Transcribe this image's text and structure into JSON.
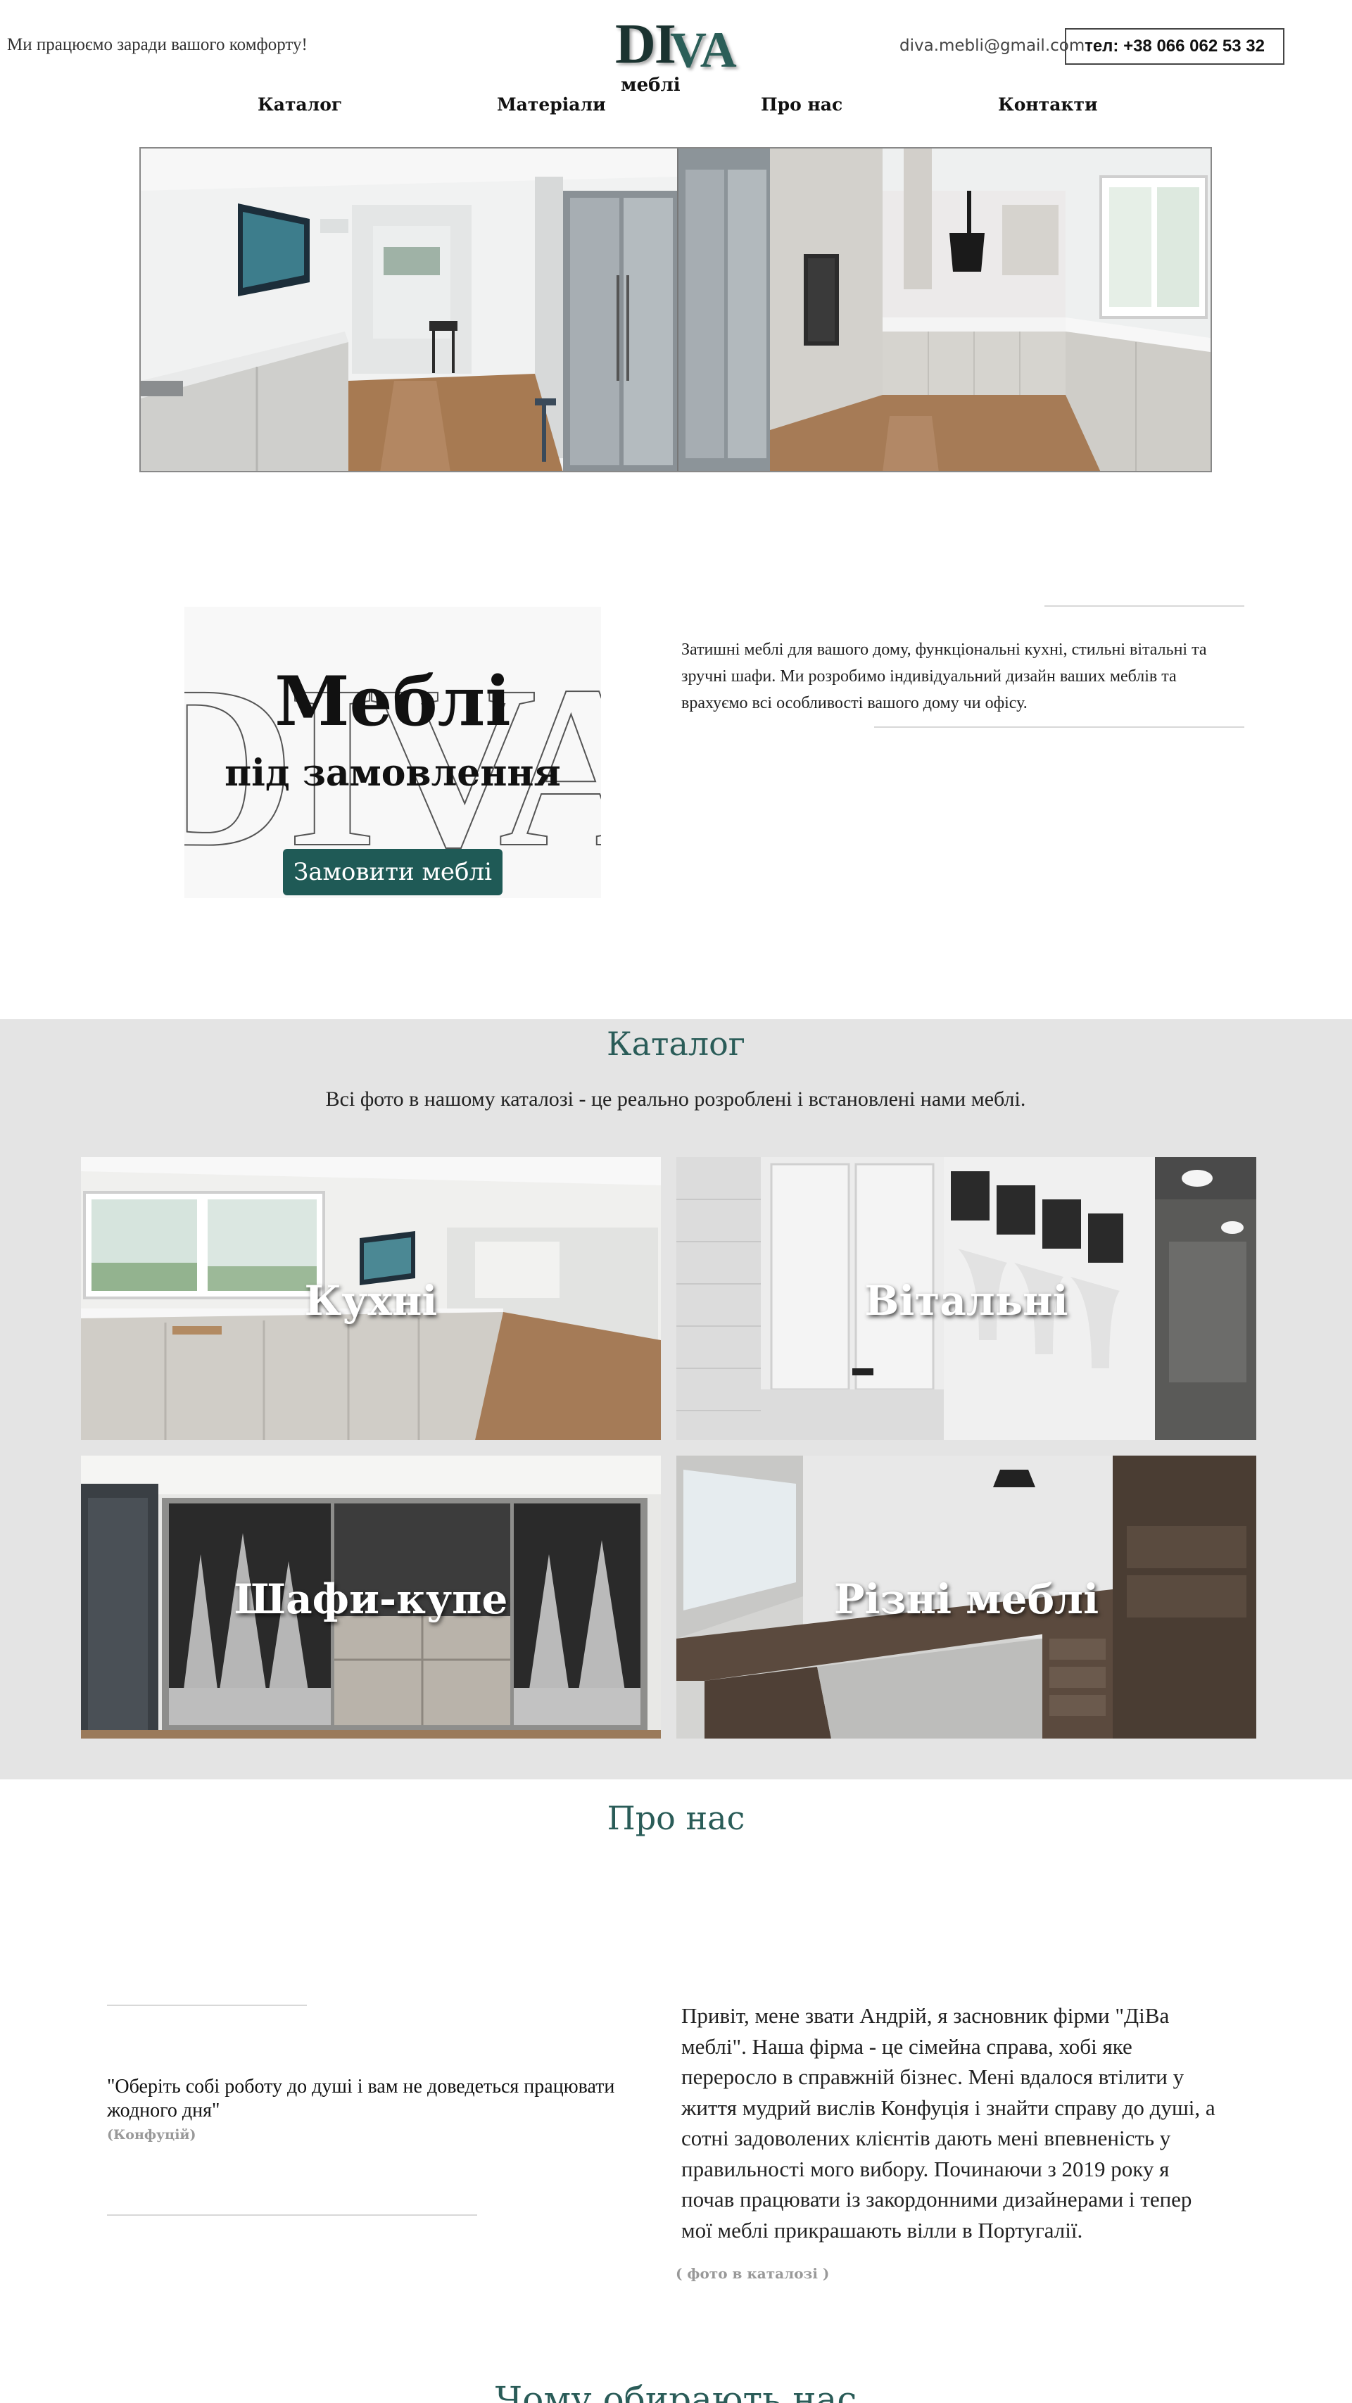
{
  "header": {
    "tagline": "Ми працюємо заради вашого комфорту!",
    "logo": {
      "part1": "DI",
      "part2": "VA",
      "subtitle": "меблі"
    },
    "email": "diva.mebli@gmail.com",
    "phone": "тел: +38 066 062 53 32"
  },
  "nav": {
    "items": [
      {
        "label": "Каталог"
      },
      {
        "label": "Матеріали"
      },
      {
        "label": "Про нас"
      },
      {
        "label": "Контакти"
      }
    ]
  },
  "promo": {
    "watermark": "DIVA",
    "title": "Меблі",
    "subtitle": "під замовлення",
    "button": "Замовити меблі",
    "text": "Затишні меблі для вашого дому, функціональні кухні, стильні вітальні та зручні шафи. Ми розробимо індивідуальний дизайн ваших меблів та врахуємо всі особливості вашого дому чи офісу."
  },
  "catalog": {
    "title": "Каталог",
    "subtitle": "Всі фото в нашому каталозі - це реально розроблені і встановлені нами меблі.",
    "tiles": [
      {
        "label": "Кухні"
      },
      {
        "label": "Вітальні"
      },
      {
        "label": "Шафи-купе"
      },
      {
        "label": "Різні меблі"
      }
    ]
  },
  "about": {
    "title": "Про нас",
    "quote": "\"Оберіть собі роботу до душі і вам не доведеться працювати жодного дня\"",
    "quote_author": "(Конфуцій)",
    "text": "Привіт, мене звати Андрій, я засновник фірми \"ДіВа меблі\". Наша фірма - це сімейна справа, хобі яке переросло в справжній бізнес. Мені вдалося втілити у життя мудрий вислів Конфуція і знайти справу до душі, а сотні задоволених клієнтів дають мені впевненість у правильності мого вибору. Починаючи з 2019 року я почав працювати із закордонними дизайнерами і тепер мої меблі прикрашають вілли в Португалії.",
    "photo_link": "( фото в каталозі )"
  },
  "why": {
    "title": "Чому обирають нас"
  },
  "colors": {
    "accent": "#2a5c58",
    "button": "#1f5a56",
    "catalog_bg": "#e4e4e4"
  }
}
